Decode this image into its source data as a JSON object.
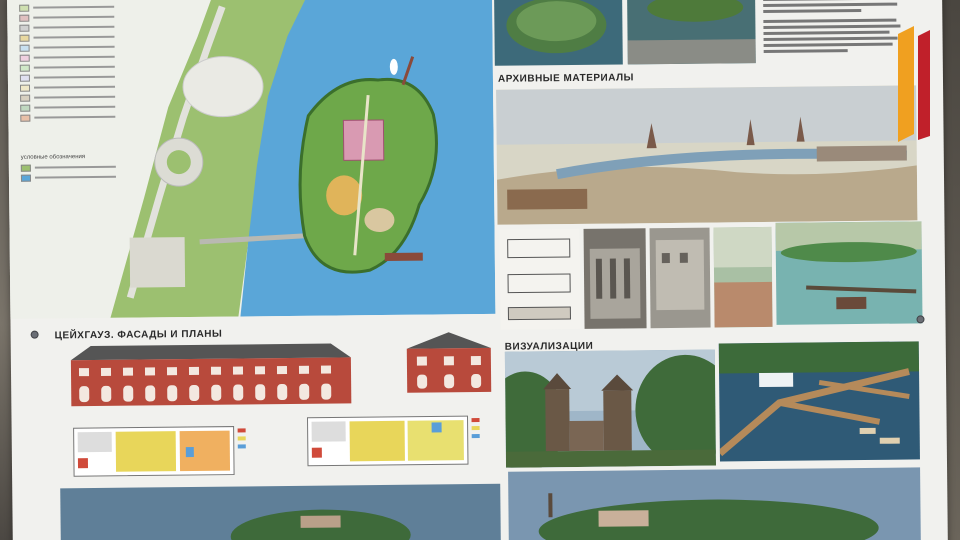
{
  "board": {
    "headings": {
      "archive": "АРХИВНЫЕ МАТЕРИАЛЫ",
      "arsenal": "ЦЕЙХГАУЗ. ФАСАДЫ И ПЛАНЫ",
      "visualization": "ВИЗУАЛИЗАЦИИ"
    },
    "legend_title": "условные обозначения"
  },
  "colors": {
    "water": "#5aa6d8",
    "park_green": "#7fae55",
    "building_red": "#b84a3c",
    "plan_yellow": "#e8d65a",
    "logo_orange": "#f0a020",
    "logo_red": "#c0202a"
  }
}
